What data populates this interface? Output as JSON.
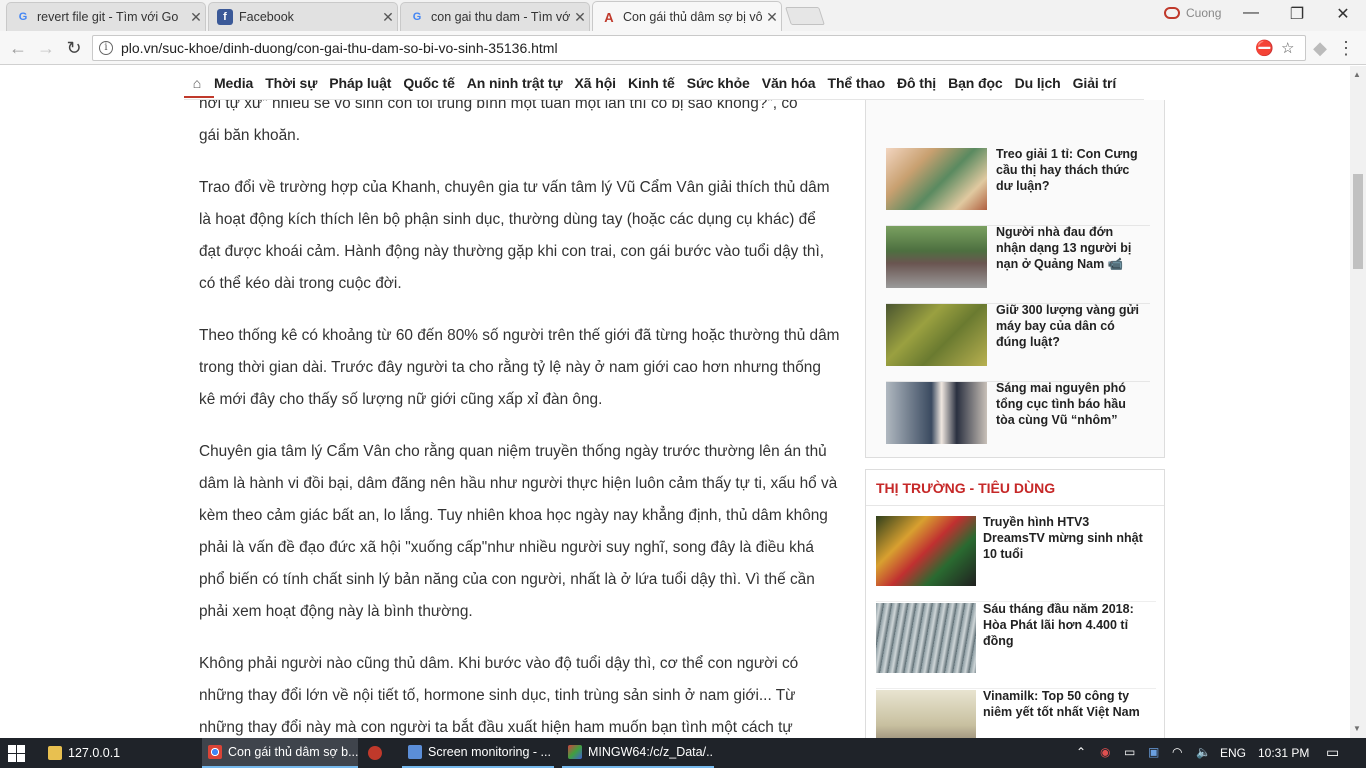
{
  "browser": {
    "tabs": [
      {
        "title": "revert file git - Tìm với Go",
        "favicon": "google-icon"
      },
      {
        "title": "Facebook",
        "favicon": "facebook-icon"
      },
      {
        "title": "con gai thu dam - Tìm với",
        "favicon": "google-icon"
      },
      {
        "title": "Con gái thủ dâm sợ bị vô",
        "favicon": "plo-icon"
      }
    ],
    "profile_name": "Cuong",
    "url": "plo.vn/suc-khoe/dinh-duong/con-gai-thu-dam-so-bi-vo-sinh-35136.html"
  },
  "nav": {
    "items": [
      "Media",
      "Thời sự",
      "Pháp luật",
      "Quốc tế",
      "An ninh trật tự",
      "Xã hội",
      "Kinh tế",
      "Sức khỏe",
      "Văn hóa",
      "Thể thao",
      "Đô thị",
      "Bạn đọc",
      "Du lịch",
      "Giải trí"
    ]
  },
  "article": {
    "partial_line": "hơi tự xử\" nhiều sẽ vô sinh con tôi trung bình một tuần một lần thì có bị sao không?\", cô",
    "paragraphs": [
      "gái băn khoăn.",
      "Trao đổi về trường hợp của Khanh, chuyên gia tư vấn tâm lý Vũ Cẩm Vân giải thích thủ dâm là hoạt động kích thích lên bộ phận sinh dục, thường dùng tay (hoặc các dụng cụ khác) để đạt được khoái cảm. Hành động này thường gặp khi con trai, con gái bước vào tuổi dậy thì, có thể kéo dài trong cuộc đời.",
      "Theo thống kê có khoảng từ 60 đến 80% số người trên thế giới đã từng hoặc thường thủ dâm trong thời gian dài. Trước đây người ta cho rằng tỷ lệ này ở nam giới cao hơn nhưng thống kê mới đây cho thấy số lượng nữ giới cũng xấp xỉ đàn ông.",
      "Chuyên gia tâm lý Cẩm Vân cho rằng quan niệm truyền thống ngày trước thường lên án thủ dâm là hành vi đồi bại, dâm đãng nên hầu như người thực hiện luôn cảm thấy tự ti, xấu hổ và kèm theo cảm giác bất an, lo lắng. Tuy nhiên khoa học ngày nay khẳng định, thủ dâm không phải là vấn đề đạo đức xã hội \"xuống cấp\"như nhiều người suy nghĩ, song đây là điều khá phổ biến có tính chất sinh lý bản năng của con người, nhất là ở lứa tuổi dậy thì. Vì thế cần phải xem hoạt động này là bình thường.",
      "Không phải người nào cũng thủ dâm. Khi bước vào độ tuổi dậy thì, cơ thể con người có những thay đổi lớn về nội tiết tố, hormone sinh dục, tinh trùng sản sinh ở nam giới... Từ những thay đổi này mà con người ta bắt đầu xuất hiện ham muốn bạn tình một cách tự"
    ]
  },
  "sidebar": {
    "items": [
      {
        "title": "Treo giải 1 tỉ: Con Cưng cầu thị hay thách thức dư luận?"
      },
      {
        "title": "Người nhà đau đớn nhận dạng 13 người bị nạn ở Quảng Nam",
        "suffix": "📹"
      },
      {
        "title": "Giữ 300 lượng vàng gửi máy bay của dân có đúng luật?"
      },
      {
        "title": "Sáng mai nguyên phó tổng cục tình báo hầu tòa cùng Vũ “nhôm”"
      }
    ]
  },
  "market": {
    "heading": "THỊ TRƯỜNG - TIÊU DÙNG",
    "items": [
      {
        "title": "Truyền hình HTV3 DreamsTV mừng sinh nhật 10 tuổi"
      },
      {
        "title": "Sáu tháng đầu năm 2018: Hòa Phát lãi hơn 4.400 tỉ đồng"
      },
      {
        "title": "Vinamilk: Top 50 công ty niêm yết tốt nhất Việt Nam"
      }
    ]
  },
  "taskbar": {
    "tasks": [
      "127.0.0.1",
      "Con gái thủ dâm sợ b...",
      "",
      "Screen monitoring - ...",
      "MINGW64:/c/z_Data/..."
    ],
    "language": "ENG",
    "time": "10:31 PM"
  }
}
